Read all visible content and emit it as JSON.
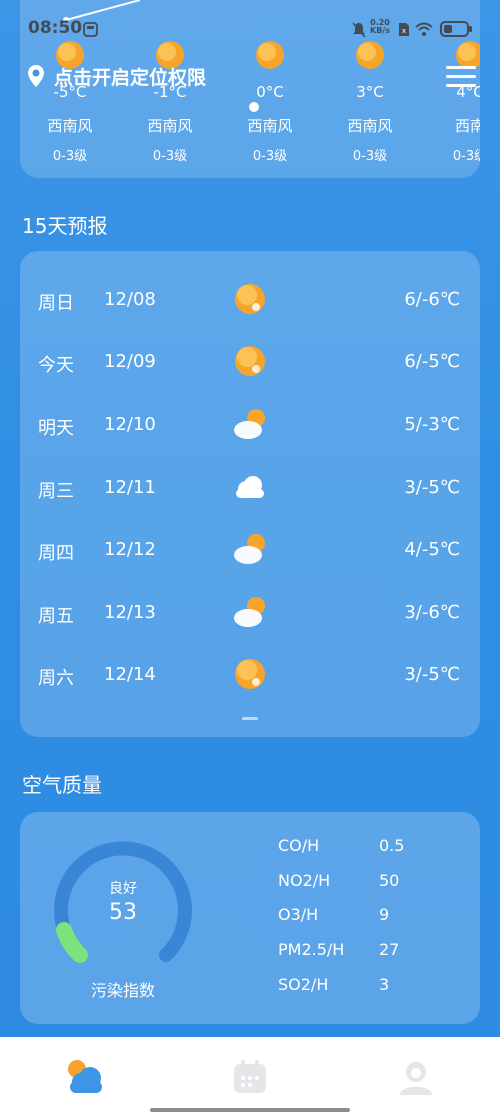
{
  "status_bar": {
    "time": "08:50",
    "net_speed_value": "0.20",
    "net_speed_unit": "KB/s"
  },
  "location": {
    "label": "点击开启定位权限"
  },
  "hourly": [
    {
      "temp": "-5°C",
      "wind": "西南风",
      "level": "0-3级"
    },
    {
      "temp": "-1°C",
      "wind": "西南风",
      "level": "0-3级"
    },
    {
      "temp": "0°C",
      "wind": "西南风",
      "level": "0-3级"
    },
    {
      "temp": "3°C",
      "wind": "西南风",
      "level": "0-3级"
    },
    {
      "temp": "4°C",
      "wind": "西南",
      "level": "0-3级"
    }
  ],
  "forecast": {
    "title": "15天预报",
    "days": [
      {
        "day": "周日",
        "date": "12/08",
        "icon": "sun-icon",
        "range": "6/-6℃"
      },
      {
        "day": "今天",
        "date": "12/09",
        "icon": "sun-icon",
        "range": "6/-5℃"
      },
      {
        "day": "明天",
        "date": "12/10",
        "icon": "partly-cloudy-icon",
        "range": "5/-3℃"
      },
      {
        "day": "周三",
        "date": "12/11",
        "icon": "cloud-icon",
        "range": "3/-5℃"
      },
      {
        "day": "周四",
        "date": "12/12",
        "icon": "partly-cloudy-icon",
        "range": "4/-5℃"
      },
      {
        "day": "周五",
        "date": "12/13",
        "icon": "partly-cloudy-icon",
        "range": "3/-6℃"
      },
      {
        "day": "周六",
        "date": "12/14",
        "icon": "sun-icon",
        "range": "3/-5℃"
      }
    ]
  },
  "air_quality": {
    "title": "空气质量",
    "level": "良好",
    "value": "53",
    "caption": "污染指数",
    "metrics": [
      {
        "name": "CO/H",
        "value": "0.5"
      },
      {
        "name": "NO2/H",
        "value": "50"
      },
      {
        "name": "O3/H",
        "value": "9"
      },
      {
        "name": "PM2.5/H",
        "value": "27"
      },
      {
        "name": "SO2/H",
        "value": "3"
      }
    ]
  },
  "colors": {
    "background": "#2f8ee4",
    "sun": "#f7a52a",
    "gauge_track": "#3a86d6",
    "gauge_fill": "#7be27c"
  }
}
